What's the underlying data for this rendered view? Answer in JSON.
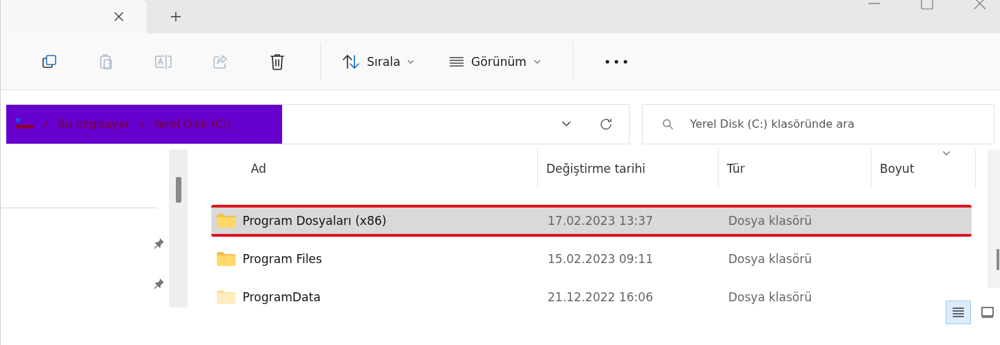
{
  "toolbar": {
    "actions": [
      {
        "kind": "copy",
        "disabled": false
      },
      {
        "kind": "paste",
        "disabled": true
      },
      {
        "kind": "rename",
        "disabled": true
      },
      {
        "kind": "share",
        "disabled": true
      },
      {
        "kind": "delete",
        "disabled": false
      }
    ],
    "sort": {
      "label": "Sırala"
    },
    "view": {
      "label": "Görünüm"
    }
  },
  "address": {
    "breadcrumb": [
      "Bu bilgisayar",
      "Yerel Disk (C:)"
    ]
  },
  "search": {
    "placeholder": "Yerel Disk (C:) klasöründe ara"
  },
  "table": {
    "columns": [
      "Ad",
      "Değiştirme tarihi",
      "Tür",
      "Boyut"
    ],
    "rows": [
      {
        "name": "Program Dosyaları (x86)",
        "date": "17.02.2023 13:37",
        "type": "Dosya klasörü",
        "selected": true,
        "annotated": true
      },
      {
        "name": "Program Files",
        "date": "15.02.2023 09:11",
        "type": "Dosya klasörü",
        "selected": false,
        "annotated": false
      },
      {
        "name": "ProgramData",
        "date": "21.12.2022 16:06",
        "type": "Dosya klasörü",
        "selected": false,
        "annotated": false
      }
    ]
  },
  "view_toggle": [
    {
      "kind": "details",
      "selected": true
    },
    {
      "kind": "tiles",
      "selected": false
    }
  ]
}
